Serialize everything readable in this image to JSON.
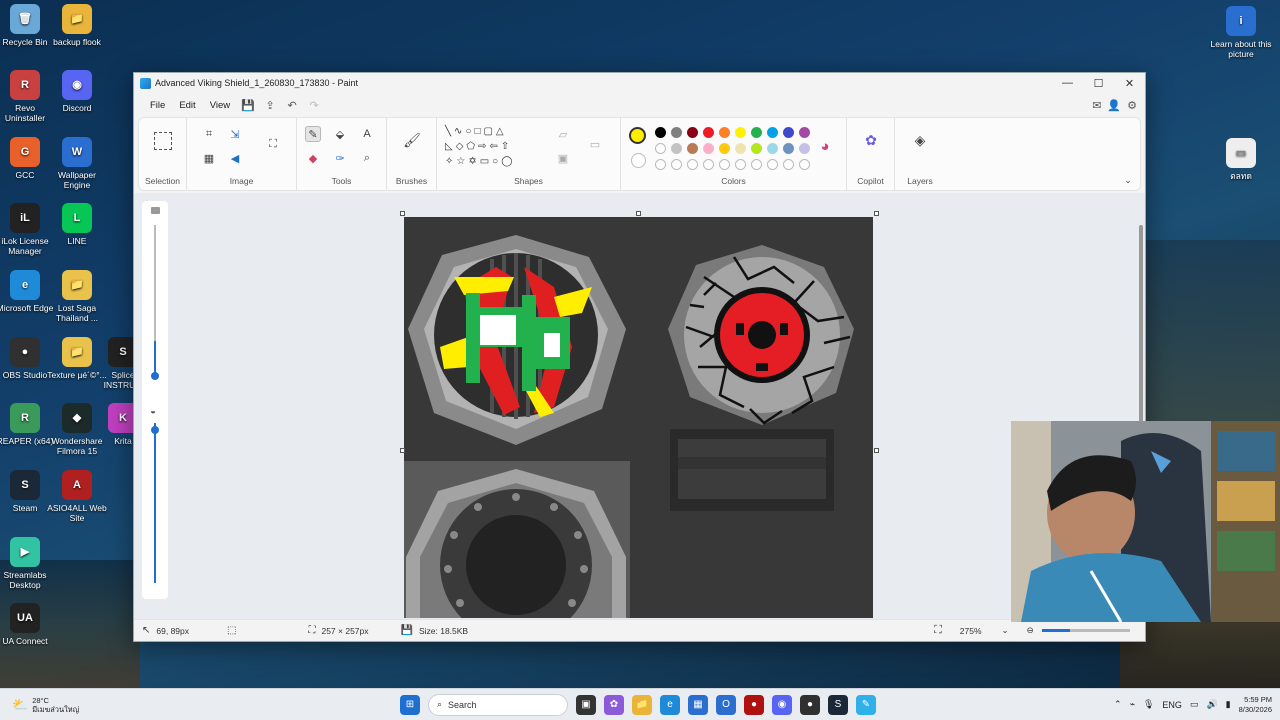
{
  "desktop": {
    "icons": [
      {
        "label": "Recycle Bin",
        "color": "#6aa8d8",
        "glyph": "🗑"
      },
      {
        "label": "backup flook",
        "color": "#e8b53a",
        "glyph": "📁"
      },
      {
        "label": "Revo Uninstaller",
        "color": "#c94040",
        "glyph": "R"
      },
      {
        "label": "Discord",
        "color": "#5865f2",
        "glyph": "◉"
      },
      {
        "label": "GCC",
        "color": "#e8602a",
        "glyph": "G"
      },
      {
        "label": "Wallpaper Engine",
        "color": "#2a6fd0",
        "glyph": "W"
      },
      {
        "label": "iLok License Manager",
        "color": "#222222",
        "glyph": "iL"
      },
      {
        "label": "LINE",
        "color": "#06c755",
        "glyph": "L"
      },
      {
        "label": "Microsoft Edge",
        "color": "#1f8bd8",
        "glyph": "e"
      },
      {
        "label": "Lost Saga Thailand ...",
        "color": "#e8c24a",
        "glyph": "📁"
      },
      {
        "label": "OBS Studio",
        "color": "#303030",
        "glyph": "●"
      },
      {
        "label": "Texture µé´©°...",
        "color": "#e8c24a",
        "glyph": "📁"
      },
      {
        "label": "Splice INSTRU...",
        "color": "#222222",
        "glyph": "S"
      },
      {
        "label": "REAPER (x64)",
        "color": "#3a9a5a",
        "glyph": "R"
      },
      {
        "label": "Wondershare Filmora 15",
        "color": "#1d2a2a",
        "glyph": "◆"
      },
      {
        "label": "Krita",
        "color": "#c040c0",
        "glyph": "K"
      },
      {
        "label": "Steam",
        "color": "#1b2838",
        "glyph": "S"
      },
      {
        "label": "ASIO4ALL Web Site",
        "color": "#b02020",
        "glyph": "A"
      },
      {
        "label": "Streamlabs Desktop",
        "color": "#31c3a2",
        "glyph": "▶"
      },
      {
        "label": "UA Connect",
        "color": "#222222",
        "glyph": "UA"
      }
    ],
    "right_icons": [
      {
        "label": "Learn about this picture",
        "color": "#2a6fd0",
        "glyph": "i"
      },
      {
        "label": "ตลทด",
        "color": "#eeeeee",
        "glyph": "▭"
      }
    ]
  },
  "window": {
    "title": "Advanced Viking Shield_1_260830_173830 - Paint",
    "controls": {
      "minimize": "—",
      "maximize": "☐",
      "close": "✕"
    }
  },
  "menu": {
    "items": [
      "File",
      "Edit",
      "View"
    ]
  },
  "ribbon": {
    "groups": {
      "selection": "Selection",
      "image": "Image",
      "tools": "Tools",
      "brushes": "Brushes",
      "shapes": "Shapes",
      "colors": "Colors",
      "copilot": "Copilot",
      "layers": "Layers"
    },
    "active_color": "#ffee00",
    "palette_row1": [
      "#000000",
      "#7f7f7f",
      "#880015",
      "#ed1c24",
      "#ff7f27",
      "#fff200",
      "#22b14c",
      "#00a2e8",
      "#3f48cc",
      "#a349a4"
    ],
    "palette_row2": [
      "#ffffff",
      "#c3c3c3",
      "#b97a57",
      "#ffaec9",
      "#ffc90e",
      "#efe4b0",
      "#b5e61d",
      "#99d9ea",
      "#7092be",
      "#c8bfe7"
    ]
  },
  "status": {
    "cursor": "69, 89px",
    "selection_size": "257 × 257px",
    "file_size": "Size: 18.5KB",
    "zoom": "275%"
  },
  "taskbar": {
    "search_placeholder": "Search",
    "weather_temp": "28°C",
    "weather_desc": "มีเมฆส่วนใหญ่",
    "language": "ENG",
    "time": "5:59 PM",
    "date": "8/30/2026"
  }
}
